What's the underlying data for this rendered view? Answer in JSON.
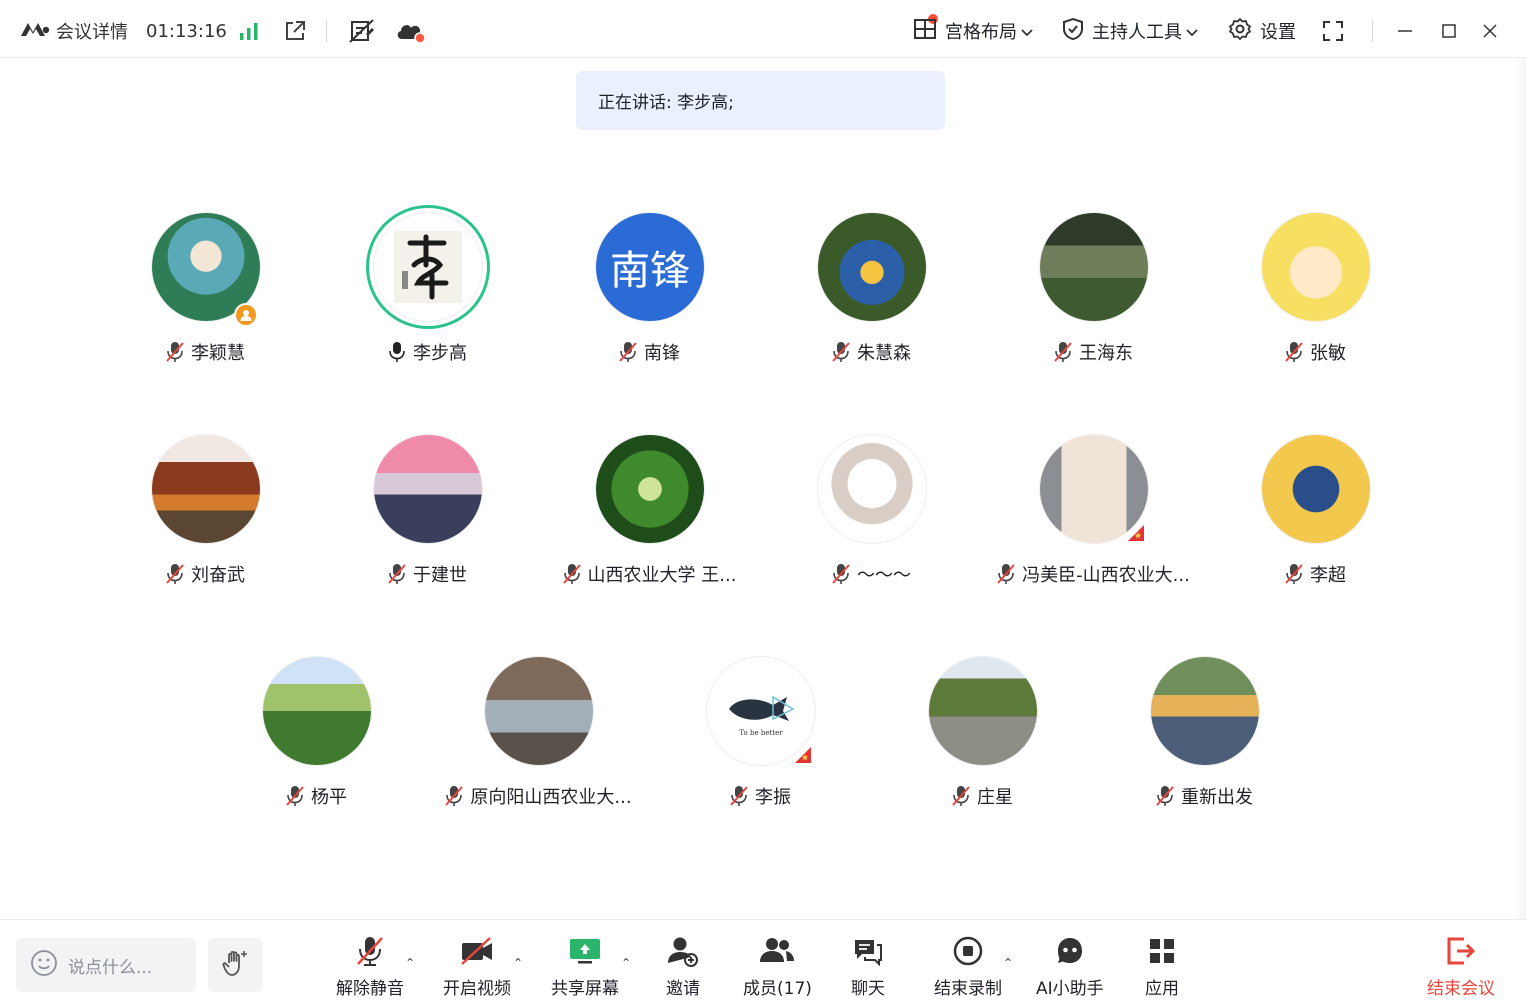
{
  "topbar": {
    "meeting_details_label": "会议详情",
    "timer": "01:13:16",
    "layout_label": "宫格布局",
    "host_tools_label": "主持人工具",
    "settings_label": "设置"
  },
  "speaking_banner": {
    "text": "正在讲话: 李步高;"
  },
  "participants": [
    {
      "name": "李颖慧",
      "mic": "muted",
      "is_host": true
    },
    {
      "name": "李步高",
      "mic": "speaking",
      "avatar_text": ""
    },
    {
      "name": "南锋",
      "mic": "muted",
      "avatar_text": "南锋"
    },
    {
      "name": "朱慧森",
      "mic": "muted"
    },
    {
      "name": "王海东",
      "mic": "muted"
    },
    {
      "name": "张敏",
      "mic": "muted"
    },
    {
      "name": "刘奋武",
      "mic": "muted"
    },
    {
      "name": "于建世",
      "mic": "muted"
    },
    {
      "name": "山西农业大学  王...",
      "mic": "muted"
    },
    {
      "name": "～～～",
      "mic": "muted"
    },
    {
      "name": "冯美臣-山西农业大...",
      "mic": "muted",
      "flag": true
    },
    {
      "name": "李超",
      "mic": "muted"
    },
    {
      "name": "杨平",
      "mic": "muted"
    },
    {
      "name": "原向阳山西农业大...",
      "mic": "muted"
    },
    {
      "name": "李振",
      "mic": "muted",
      "flag": true,
      "avatar_caption": "To be better"
    },
    {
      "name": "庄星",
      "mic": "muted"
    },
    {
      "name": "重新出发",
      "mic": "muted"
    }
  ],
  "bottombar": {
    "say_placeholder": "说点什么...",
    "unmute_label": "解除静音",
    "video_label": "开启视频",
    "share_label": "共享屏幕",
    "invite_label": "邀请",
    "members_label": "成员(17)",
    "chat_label": "聊天",
    "stop_record_label": "结束录制",
    "ai_label": "AI小助手",
    "apps_label": "应用",
    "end_label": "结束会议"
  },
  "colors": {
    "speaking_ring": "#2bc38b",
    "end_red": "#e8463c",
    "banner_bg": "#eaf0fd",
    "avatar_blue": "#2b6bd6"
  }
}
